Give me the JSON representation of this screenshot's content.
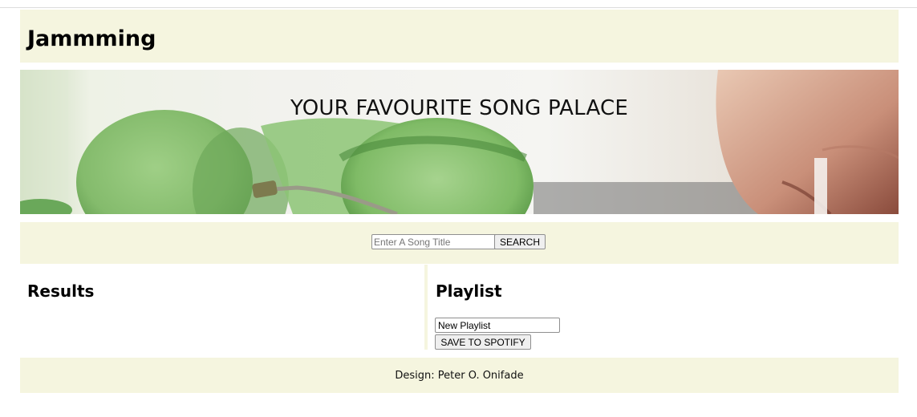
{
  "header": {
    "title": "Jammming"
  },
  "hero": {
    "title": "YOUR FAVOURITE SONG PALACE",
    "image": "green-headphones-photo"
  },
  "search": {
    "placeholder": "Enter A Song Title",
    "value": "",
    "button_label": "SEARCH"
  },
  "results": {
    "title": "Results",
    "items": []
  },
  "playlist": {
    "title": "Playlist",
    "name_value": "New Playlist",
    "save_label": "SAVE TO SPOTIFY",
    "items": []
  },
  "footer": {
    "text": "Design: Peter O. Onifade"
  },
  "colors": {
    "panel_bg": "#f5f5df",
    "page_bg": "#ffffff",
    "headphone_green": "#8fc27a"
  }
}
